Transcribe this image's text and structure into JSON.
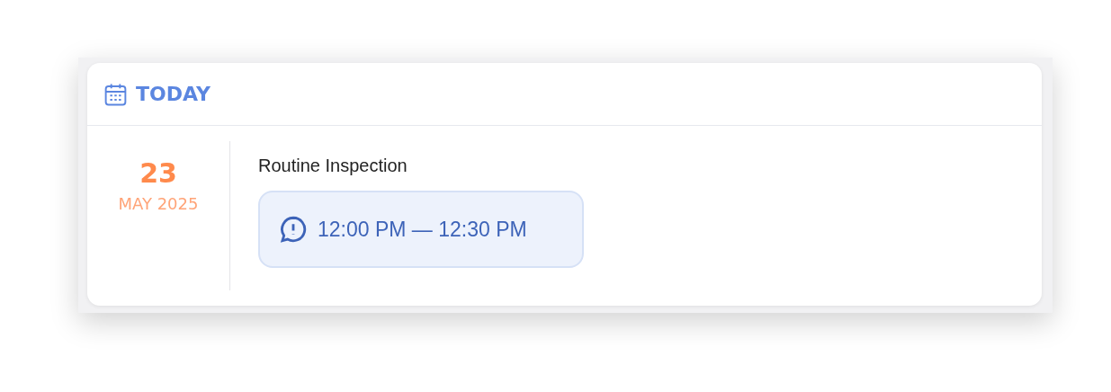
{
  "header": {
    "title": "TODAY"
  },
  "event": {
    "day": "23",
    "month_year": "MAY 2025",
    "title": "Routine Inspection",
    "time": "12:00 PM — 12:30 PM"
  }
}
